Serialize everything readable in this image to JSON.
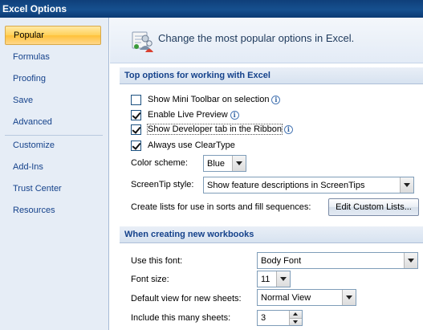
{
  "window": {
    "title": "Excel Options"
  },
  "sidebar": {
    "items": [
      {
        "label": "Popular",
        "selected": true
      },
      {
        "label": "Formulas"
      },
      {
        "label": "Proofing"
      },
      {
        "label": "Save"
      },
      {
        "label": "Advanced"
      },
      {
        "label": "Customize"
      },
      {
        "label": "Add-Ins"
      },
      {
        "label": "Trust Center"
      },
      {
        "label": "Resources"
      }
    ]
  },
  "header": {
    "text": "Change the most popular options in Excel.",
    "icon": "options-people-icon"
  },
  "sections": {
    "top_options": {
      "title": "Top options for working with Excel",
      "show_mini_toolbar": {
        "label": "Show Mini Toolbar on selection",
        "checked": false
      },
      "enable_live_preview": {
        "label": "Enable Live Preview",
        "checked": true
      },
      "show_developer_tab": {
        "label": "Show Developer tab in the Ribbon",
        "checked": true
      },
      "always_use_cleartype": {
        "label": "Always use ClearType",
        "checked": true
      },
      "color_scheme": {
        "label": "Color scheme:",
        "value": "Blue"
      },
      "screentip_style": {
        "label": "ScreenTip style:",
        "value": "Show feature descriptions in ScreenTips"
      },
      "custom_lists": {
        "label": "Create lists for use in sorts and fill sequences:",
        "button": "Edit Custom Lists..."
      }
    },
    "new_workbooks": {
      "title": "When creating new workbooks",
      "font": {
        "label": "Use this font:",
        "value": "Body Font"
      },
      "font_size": {
        "label": "Font size:",
        "value": "11"
      },
      "default_view": {
        "label": "Default view for new sheets:",
        "value": "Normal View"
      },
      "sheet_count": {
        "label": "Include this many sheets:",
        "value": "3"
      }
    }
  },
  "colors": {
    "title_bar": "#16508f",
    "sidebar_bg": "#e6edf6",
    "selected_item": "#ffd15a",
    "section_text": "#15428b"
  }
}
